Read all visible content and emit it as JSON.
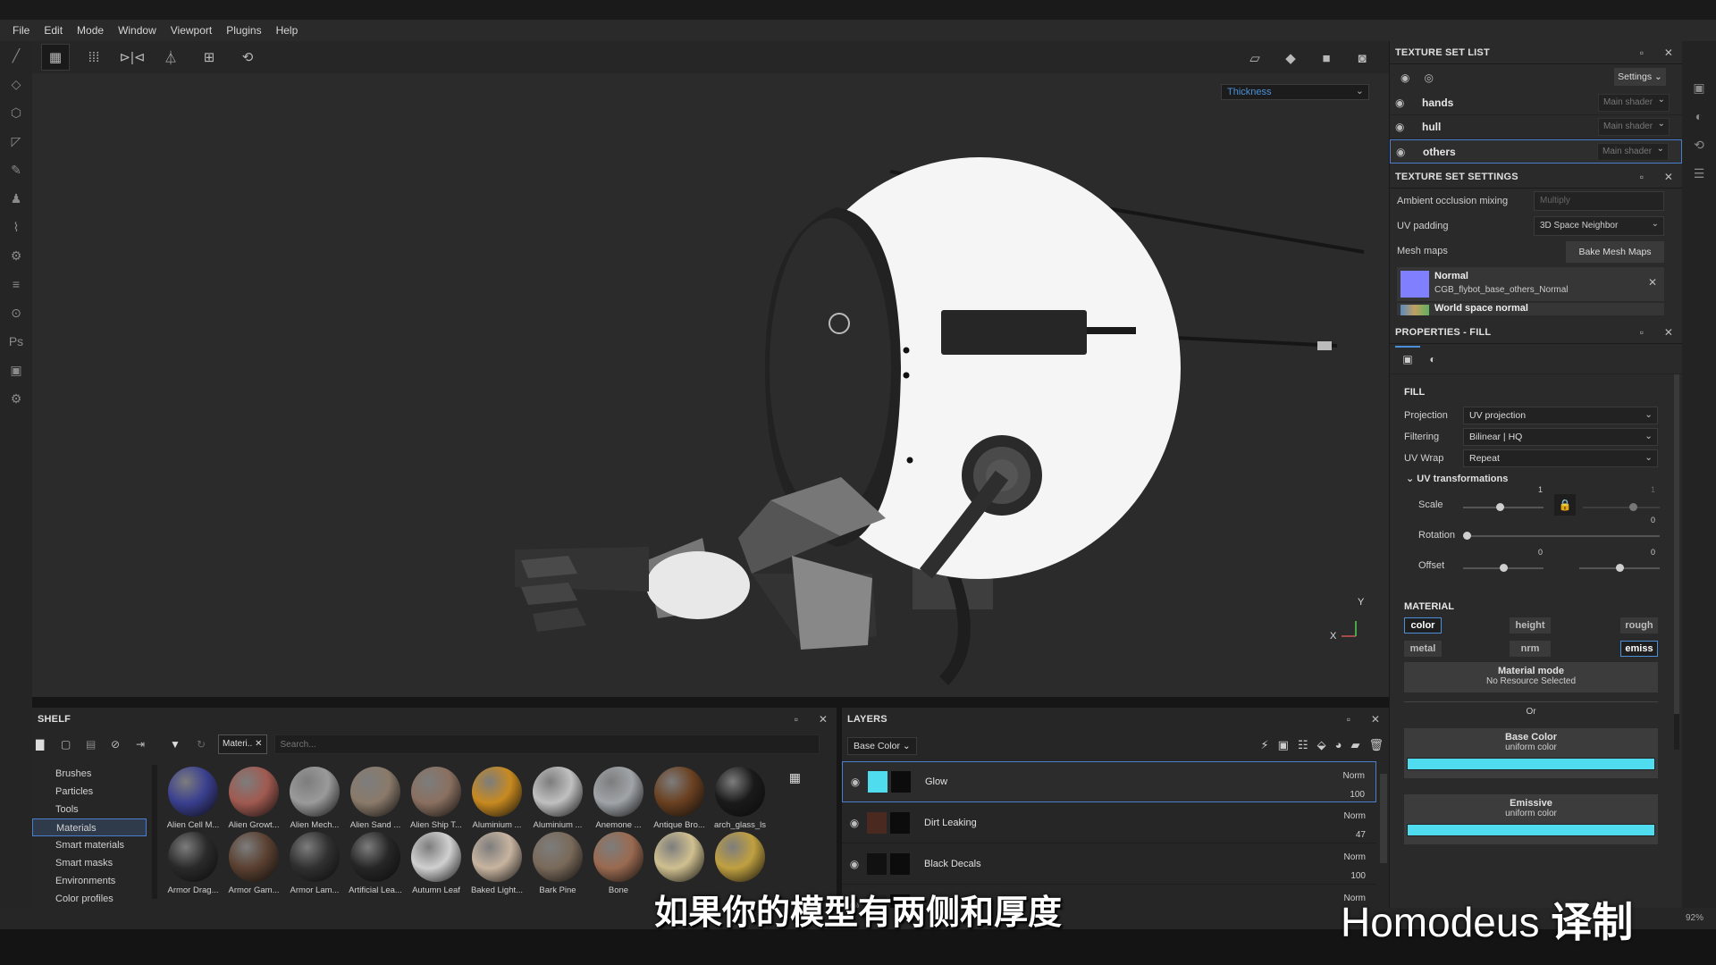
{
  "menu": [
    "File",
    "Edit",
    "Mode",
    "Window",
    "Viewport",
    "Plugins",
    "Help"
  ],
  "viewport": {
    "channel_select": "Thickness",
    "axis_y": "Y",
    "axis_x": "X"
  },
  "texture_set_list": {
    "title": "TEXTURE SET LIST",
    "settings_label": "Settings",
    "sets": [
      {
        "name": "hands",
        "shader": "Main shader"
      },
      {
        "name": "hull",
        "shader": "Main shader"
      },
      {
        "name": "others",
        "shader": "Main shader",
        "selected": true
      }
    ]
  },
  "texture_set_settings": {
    "title": "TEXTURE SET SETTINGS",
    "ao_label": "Ambient occlusion mixing",
    "ao_value": "Multiply",
    "uv_padding_label": "UV padding",
    "uv_padding_value": "3D Space Neighbor",
    "mesh_maps_label": "Mesh maps",
    "bake_button": "Bake Mesh Maps",
    "maps": [
      {
        "name": "Normal",
        "file": "CGB_flybot_base_others_Normal"
      },
      {
        "name": "World space normal"
      }
    ]
  },
  "properties": {
    "title": "PROPERTIES - FILL",
    "fill_section": "FILL",
    "projection_label": "Projection",
    "projection_value": "UV projection",
    "filtering_label": "Filtering",
    "filtering_value": "Bilinear | HQ",
    "uvwrap_label": "UV Wrap",
    "uvwrap_value": "Repeat",
    "uvtrans_label": "UV transformations",
    "scale_label": "Scale",
    "scale_values": [
      "1",
      "1"
    ],
    "scale_level": 0.45,
    "rotation_label": "Rotation",
    "rotation_value": "0",
    "offset_label": "Offset",
    "offset_values": [
      "0",
      "0"
    ],
    "offset_level": 0.5,
    "material_section": "MATERIAL",
    "channels": [
      {
        "label": "color",
        "on": true
      },
      {
        "label": "height",
        "on": false
      },
      {
        "label": "rough",
        "on": false
      },
      {
        "label": "metal",
        "on": false
      },
      {
        "label": "nrm",
        "on": false
      },
      {
        "label": "emiss",
        "on": true
      }
    ],
    "material_mode_label": "Material mode",
    "material_mode_sub": "No Resource Selected",
    "or_label": "Or",
    "base_color_label": "Base Color",
    "base_color_sub": "uniform color",
    "emissive_label": "Emissive",
    "emissive_sub": "uniform color",
    "base_color_hex": "#4fdcef",
    "emissive_hex": "#4fdcef"
  },
  "shelf": {
    "title": "SHELF",
    "filter_tag": "Materi..",
    "search_placeholder": "Search...",
    "categories": [
      "Brushes",
      "Particles",
      "Tools",
      "Materials",
      "Smart materials",
      "Smart masks",
      "Environments",
      "Color profiles"
    ],
    "selected_category": "Materials",
    "materials": [
      {
        "name": "Alien Cell M...",
        "color": "#3a3f8f"
      },
      {
        "name": "Alien Growt...",
        "color": "#a05a50"
      },
      {
        "name": "Alien Mech...",
        "color": "#9a9a9a"
      },
      {
        "name": "Alien Sand ...",
        "color": "#8a7a6a"
      },
      {
        "name": "Alien Ship T...",
        "color": "#8a7060"
      },
      {
        "name": "Aluminium ...",
        "color": "#c88a20"
      },
      {
        "name": "Aluminium ...",
        "color": "#c0c0c0"
      },
      {
        "name": "Anemone ...",
        "color": "#a0a4a8"
      },
      {
        "name": "Antique Bro...",
        "color": "#6a4020"
      },
      {
        "name": "arch_glass_ls",
        "color": "#1a1a1a"
      },
      {
        "name": "Armor Drag...",
        "color": "#2a2a2a"
      },
      {
        "name": "Armor Gam...",
        "color": "#5a4030"
      },
      {
        "name": "Armor Lam...",
        "color": "#303030"
      },
      {
        "name": "Artificial Lea...",
        "color": "#262626"
      },
      {
        "name": "Autumn Leaf",
        "color": "#d0d0d0"
      },
      {
        "name": "Baked Light...",
        "color": "#c8b4a0"
      },
      {
        "name": "Bark Pine",
        "color": "#7a6a5a"
      },
      {
        "name": "Bone",
        "color": "#9a6a50"
      },
      {
        "name": "",
        "color": "#d0c090"
      },
      {
        "name": "",
        "color": "#c0a040"
      }
    ]
  },
  "layers": {
    "title": "LAYERS",
    "channel": "Base Color",
    "items": [
      {
        "name": "Glow",
        "blend": "Norm",
        "opacity": "100",
        "thumb": "#4fdcef",
        "selected": true
      },
      {
        "name": "Dirt Leaking",
        "blend": "Norm",
        "opacity": "47",
        "thumb": "#4a2a20"
      },
      {
        "name": "Black Decals",
        "blend": "Norm",
        "opacity": "100",
        "thumb": "#111111"
      },
      {
        "name": "",
        "blend": "Norm",
        "opacity": "",
        "thumb": "#222222"
      }
    ]
  },
  "status": {
    "zoom": "92%"
  },
  "overlay": {
    "subtitle": "如果你的模型有两侧和厚度",
    "watermark_name": "Homodeus",
    "watermark_suffix": "译制"
  }
}
